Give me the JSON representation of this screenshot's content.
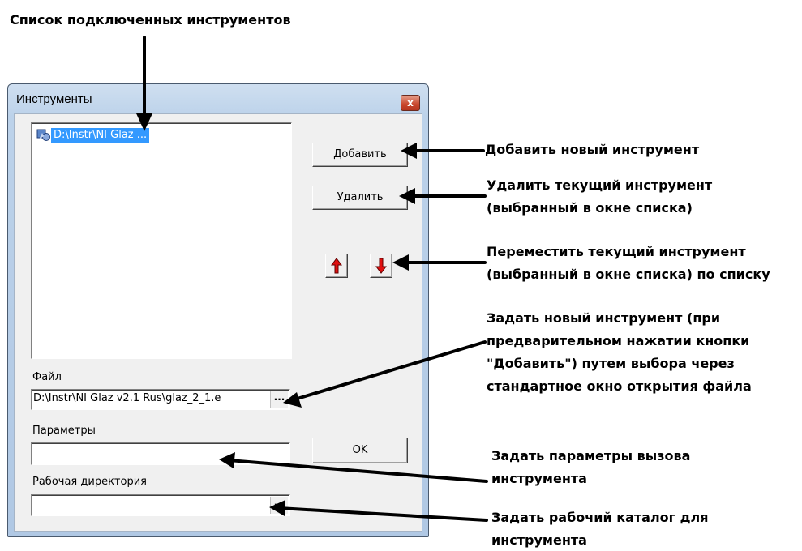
{
  "window": {
    "title": "Инструменты",
    "close_symbol": "x"
  },
  "list": {
    "items": [
      {
        "label": "D:\\Instr\\NI Glaz ...",
        "selected": true,
        "icon": "instrument-icon"
      }
    ]
  },
  "buttons": {
    "add": "Добавить",
    "remove": "Удалить",
    "ok": "OK",
    "move_up_icon": "arrow-up-icon",
    "move_down_icon": "arrow-down-icon",
    "browse_symbol": "..."
  },
  "fields": {
    "file": {
      "label": "Файл",
      "value": "D:\\Instr\\NI Glaz v2.1 Rus\\glaz_2_1.e"
    },
    "params": {
      "label": "Параметры",
      "value": ""
    },
    "workdir": {
      "label": "Рабочая директория",
      "value": ""
    }
  },
  "annotations": {
    "list_title": "Список подключенных инструментов",
    "add": "Добавить новый инструмент",
    "remove_line1": "Удалить текущий инструмент",
    "remove_line2": "(выбранный в окне списка)",
    "move_line1": "Переместить текущий инструмент",
    "move_line2": "(выбранный в окне списка) по списку",
    "file_line1": "Задать новый инструмент (при",
    "file_line2": "предварительном нажатии кнопки",
    "file_line3": "\"Добавить\") путем выбора через",
    "file_line4": "стандартное окно открытия файла",
    "params_line1": "Задать параметры вызова",
    "params_line2": "инструмента",
    "workdir_line1": "Задать рабочий каталог для",
    "workdir_line2": "инструмента"
  },
  "colors": {
    "selection": "#3399ff",
    "arrow_red": "#e01010",
    "frame": "#bcd2ea"
  }
}
